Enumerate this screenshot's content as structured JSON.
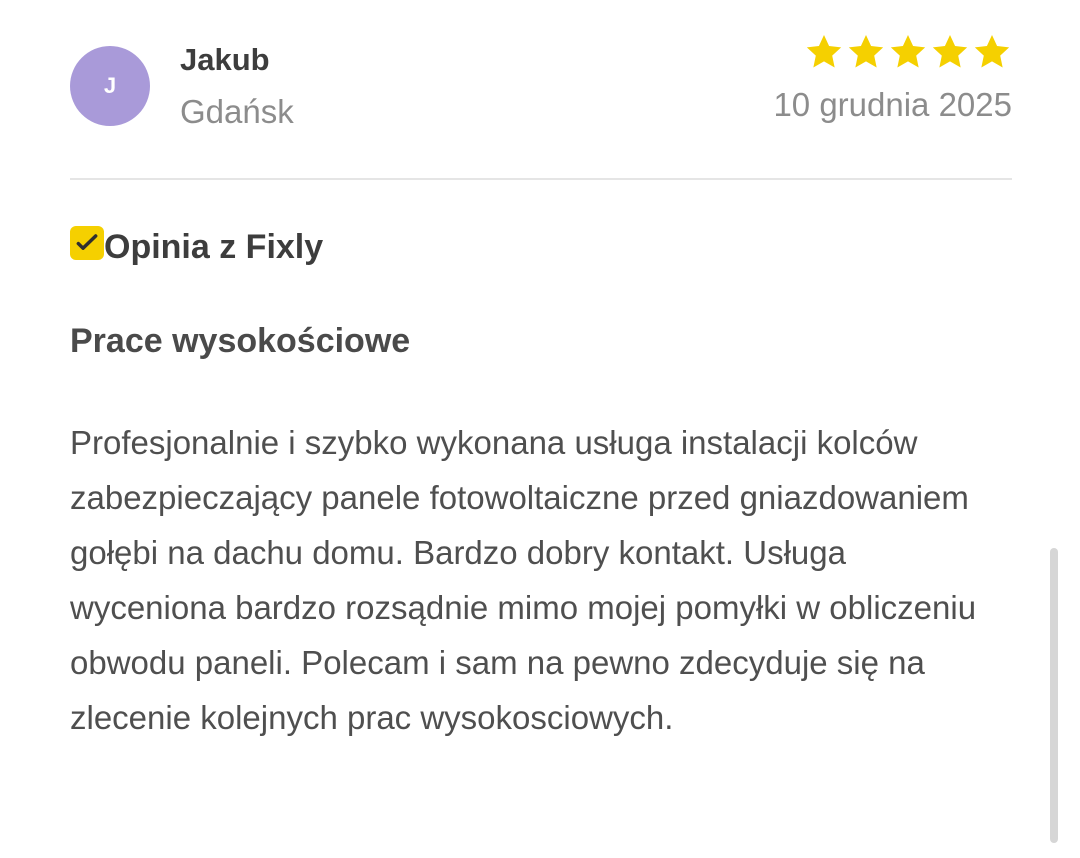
{
  "review": {
    "avatar_initial": "J",
    "author_name": "Jakub",
    "author_city": "Gdańsk",
    "rating": 5,
    "rating_max": 5,
    "date": "10 grudnia 2025",
    "source_label": "Opinia z Fixly",
    "service_title": "Prace wysokościowe",
    "text": "Profesjonalnie i szybko wykonana usługa instalacji kolców zabezpieczający panele fotowoltaiczne przed gniazdowaniem gołębi na dachu domu. Bardzo dobry kontakt. Usługa wyceniona bardzo rozsądnie mimo mojej pomyłki w obliczeniu obwodu paneli. Polecam i sam na pewno zdecyduje się na zlecenie kolejnych prac wysokosciowych."
  },
  "icons": {
    "rating_star": "star-icon",
    "source_badge": "checkmark-icon"
  },
  "colors": {
    "star": "#f5d000",
    "badge": "#f5d000",
    "avatar": "#a99ad9"
  }
}
